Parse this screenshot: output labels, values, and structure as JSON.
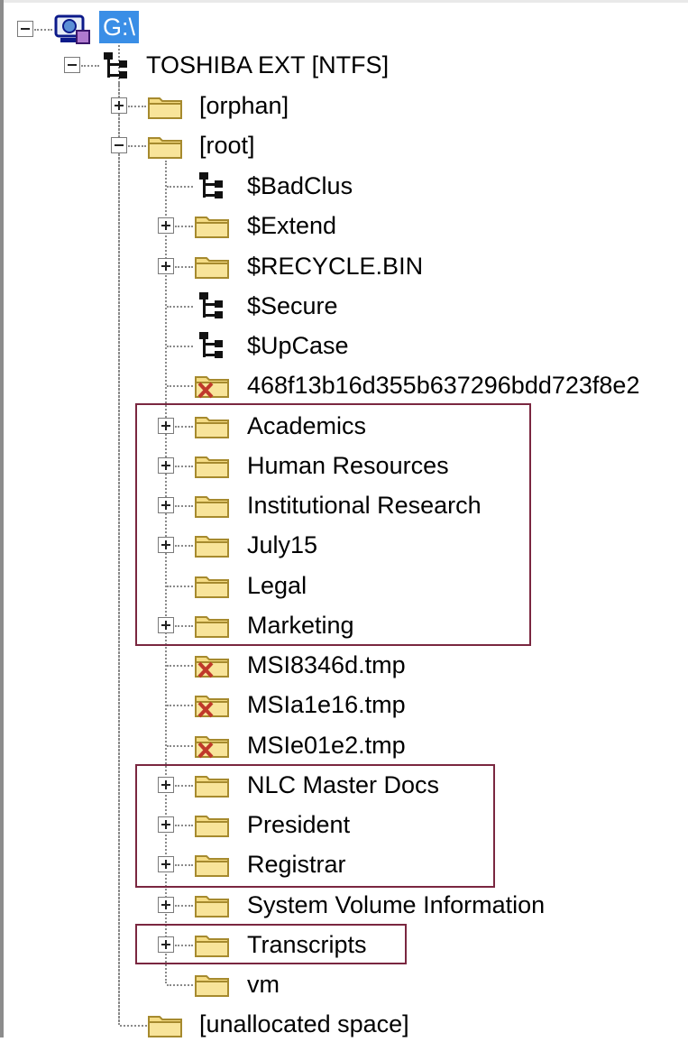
{
  "tree": {
    "drive": {
      "label": "G:\\",
      "icon": "drive-network-icon"
    },
    "volume": {
      "label": "TOSHIBA EXT [NTFS]",
      "icon": "volume-tree-icon"
    },
    "orphan": {
      "label": "[orphan]",
      "icon": "folder-icon"
    },
    "root": {
      "label": "[root]",
      "icon": "folder-icon"
    },
    "children": [
      {
        "label": "$BadClus",
        "icon": "system-file-tree-icon",
        "expandable": false
      },
      {
        "label": "$Extend",
        "icon": "folder-icon",
        "expandable": true
      },
      {
        "label": "$RECYCLE.BIN",
        "icon": "folder-icon",
        "expandable": true
      },
      {
        "label": "$Secure",
        "icon": "system-file-tree-icon",
        "expandable": false
      },
      {
        "label": "$UpCase",
        "icon": "system-file-tree-icon",
        "expandable": false
      },
      {
        "label": "468f13b16d355b637296bdd723f8e2",
        "icon": "deleted-folder-icon",
        "expandable": false
      },
      {
        "label": "Academics",
        "icon": "folder-icon",
        "expandable": true
      },
      {
        "label": "Human Resources",
        "icon": "folder-icon",
        "expandable": true
      },
      {
        "label": "Institutional Research",
        "icon": "folder-icon",
        "expandable": true
      },
      {
        "label": "July15",
        "icon": "folder-icon",
        "expandable": true
      },
      {
        "label": "Legal",
        "icon": "folder-icon",
        "expandable": false
      },
      {
        "label": "Marketing",
        "icon": "folder-icon",
        "expandable": true
      },
      {
        "label": "MSI8346d.tmp",
        "icon": "deleted-folder-icon",
        "expandable": false
      },
      {
        "label": "MSIa1e16.tmp",
        "icon": "deleted-folder-icon",
        "expandable": false
      },
      {
        "label": "MSIe01e2.tmp",
        "icon": "deleted-folder-icon",
        "expandable": false
      },
      {
        "label": "NLC Master Docs",
        "icon": "folder-icon",
        "expandable": true
      },
      {
        "label": "President",
        "icon": "folder-icon",
        "expandable": true
      },
      {
        "label": "Registrar",
        "icon": "folder-icon",
        "expandable": true
      },
      {
        "label": "System Volume Information",
        "icon": "folder-icon",
        "expandable": true
      },
      {
        "label": "Transcripts",
        "icon": "folder-icon",
        "expandable": true
      },
      {
        "label": "vm",
        "icon": "folder-icon",
        "expandable": false
      }
    ],
    "unallocated": {
      "label": "[unallocated space]",
      "icon": "folder-icon"
    }
  },
  "colors": {
    "selection": "#3a8ee6",
    "highlight_box": "#7a2740",
    "folder_fill": "#f5dc84",
    "deleted_mark": "#c0392b"
  }
}
